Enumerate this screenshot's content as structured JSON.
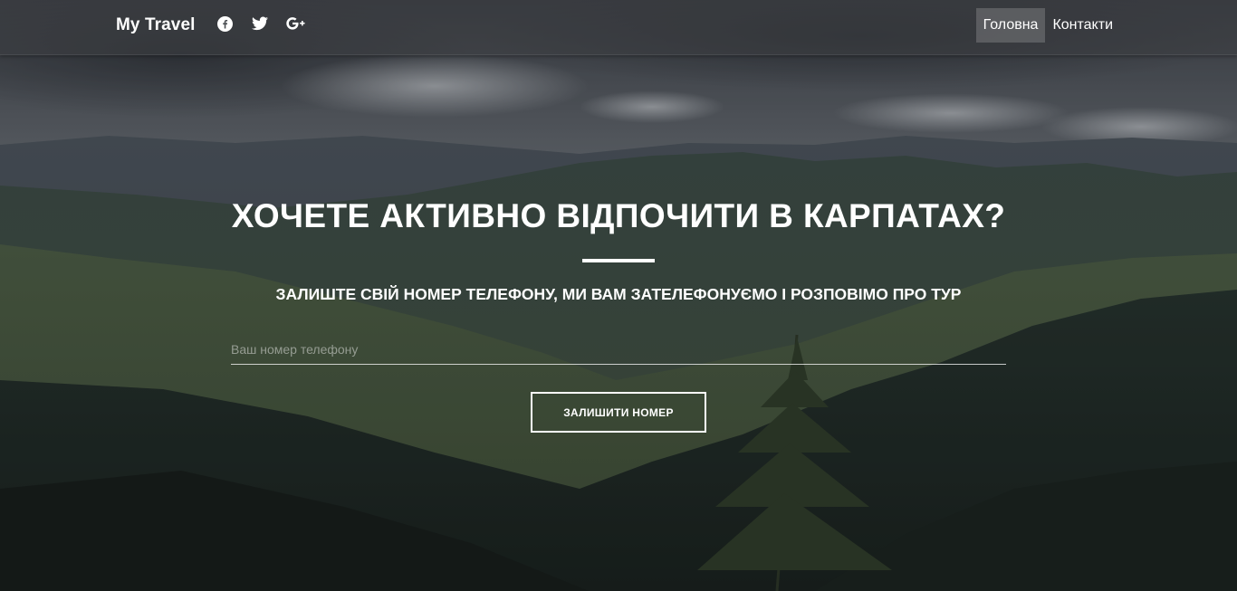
{
  "navbar": {
    "brand": "My Travel",
    "social_icons": [
      "facebook-icon",
      "twitter-icon",
      "google-plus-icon"
    ],
    "links": [
      {
        "label": "Головна",
        "active": true
      },
      {
        "label": "Контакти",
        "active": false
      }
    ]
  },
  "hero": {
    "title": "ХОЧЕТЕ АКТИВНО ВІДПОЧИТИ В КАРПАТАХ?",
    "subtitle": "ЗАЛИШТЕ СВІЙ НОМЕР ТЕЛЕФОНУ, МИ ВАМ ЗАТЕЛЕФОНУЄМО І РОЗПОВІМО ПРО ТУР",
    "phone_placeholder": "Ваш номер телефону",
    "phone_value": "",
    "submit_label": "ЗАЛИШИТИ НОМЕР"
  },
  "colors": {
    "text": "#ffffff",
    "navbar_bg": "#3c3e42"
  }
}
